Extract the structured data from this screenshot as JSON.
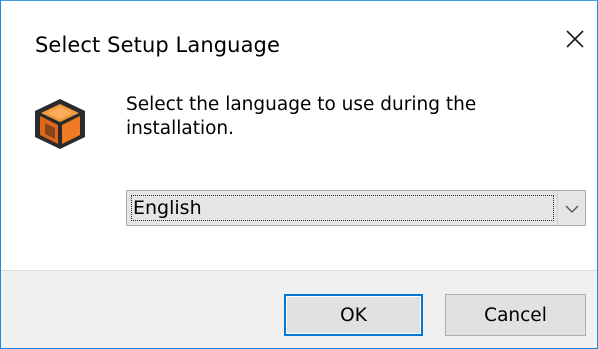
{
  "window": {
    "title": "Select Setup Language",
    "close_icon": "close-icon"
  },
  "content": {
    "app_icon": "installer-box-icon",
    "prompt": "Select the language to use during the installation."
  },
  "language_select": {
    "selected_value": "English",
    "dropdown_icon": "chevron-down-icon"
  },
  "buttons": {
    "ok_label": "OK",
    "cancel_label": "Cancel"
  },
  "colors": {
    "window_border": "#1e8ad6",
    "default_button_border": "#0078d7",
    "footer_background": "#f0f0f0",
    "icon_orange": "#f07b22",
    "icon_dark": "#2b2b2b"
  }
}
